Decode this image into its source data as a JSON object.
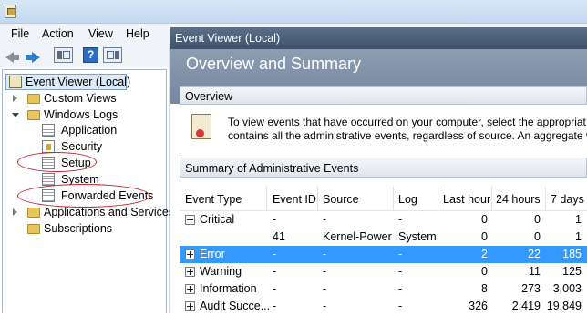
{
  "menu": {
    "file": "File",
    "action": "Action",
    "view": "View",
    "help": "Help"
  },
  "tree": {
    "root": "Event Viewer (Local)",
    "custom_views": "Custom Views",
    "windows_logs": "Windows Logs",
    "application": "Application",
    "security": "Security",
    "setup": "Setup",
    "system": "System",
    "forwarded_events": "Forwarded Events",
    "apps_services": "Applications and Services",
    "subscriptions": "Subscriptions"
  },
  "right": {
    "header": "Event Viewer (Local)",
    "banner": "Overview and Summary",
    "overview_title": "Overview",
    "overview_line1": "To view events that have occurred on your computer, select the appropriat",
    "overview_line2": "contains all the administrative events, regardless of source. An aggregate vi",
    "summary_title": "Summary of Administrative Events"
  },
  "table": {
    "columns": [
      "Event Type",
      "Event ID",
      "Source",
      "Log",
      "Last hour",
      "24 hours",
      "7 days"
    ],
    "rows": [
      {
        "type": "Critical",
        "id": "-",
        "source": "-",
        "log": "-",
        "hour": "0",
        "day": "0",
        "week": "1"
      },
      {
        "type": "",
        "id": "41",
        "source": "Kernel-Power",
        "log": "System",
        "hour": "0",
        "day": "0",
        "week": "1"
      },
      {
        "type": "Error",
        "id": "-",
        "source": "-",
        "log": "-",
        "hour": "2",
        "day": "22",
        "week": "185"
      },
      {
        "type": "Warning",
        "id": "-",
        "source": "-",
        "log": "-",
        "hour": "0",
        "day": "11",
        "week": "125"
      },
      {
        "type": "Information",
        "id": "-",
        "source": "-",
        "log": "-",
        "hour": "8",
        "day": "273",
        "week": "3,003"
      },
      {
        "type": "Audit Succe...",
        "id": "-",
        "source": "-",
        "log": "-",
        "hour": "326",
        "day": "2,419",
        "week": "19,849"
      }
    ]
  },
  "colors": {
    "selection": "#3399ff",
    "annotation": "#c0212d",
    "header": "#3f526b"
  }
}
